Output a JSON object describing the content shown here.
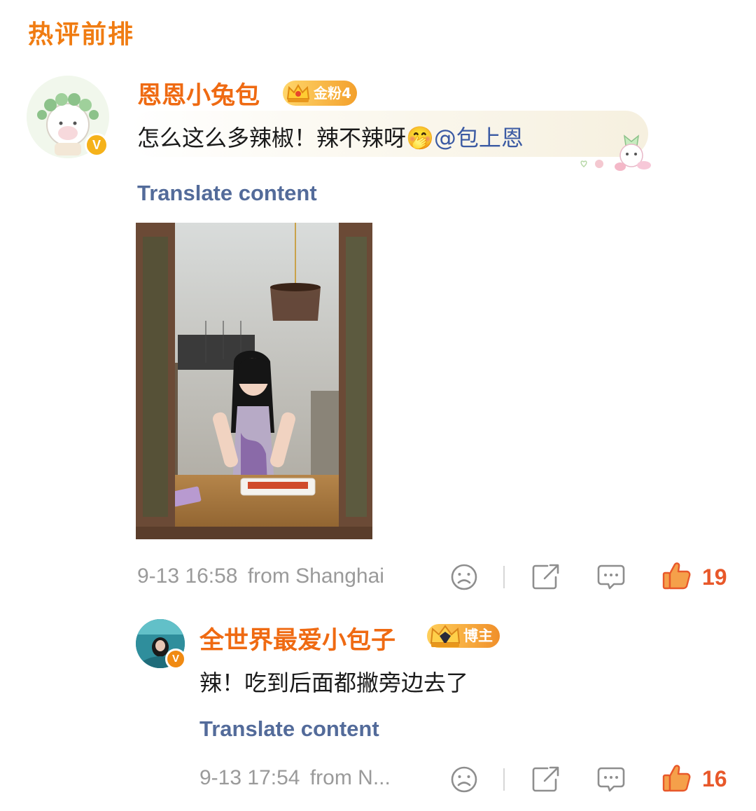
{
  "section": {
    "title": "热评前排"
  },
  "comment": {
    "username": "恩恩小兔包",
    "fan_badge": "金粉4",
    "text": "怎么这么多辣椒！辣不辣呀",
    "emoji": "🤭",
    "mention": "@包上恩",
    "translate": "Translate content",
    "meta": {
      "date": "9-13",
      "time": "16:58",
      "location": "from Shanghai"
    },
    "likes": "19",
    "icons": [
      "dislike-icon",
      "share-icon",
      "comment-icon",
      "thumbs-up-icon"
    ],
    "verified_mark": "V"
  },
  "reply": {
    "username": "全世界最爱小包子",
    "badge": "博主",
    "text": "辣！吃到后面都撇旁边去了",
    "translate": "Translate content",
    "meta": {
      "date": "9-13",
      "time": "17:54",
      "location": "from N..."
    },
    "likes": "16",
    "verified_mark": "V"
  },
  "colors": {
    "accent_orange": "#ef6a12",
    "link_blue": "#536b9a",
    "like_red": "#e8582a",
    "meta_gray": "#9a9a9a"
  }
}
